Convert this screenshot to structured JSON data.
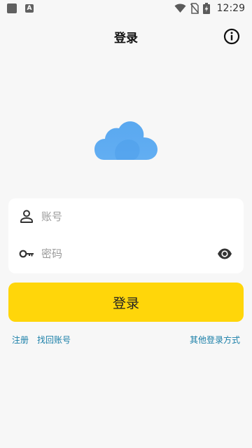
{
  "status_bar": {
    "time": "12:29",
    "icons": [
      "notification-square-icon",
      "a-badge-icon",
      "wifi-icon",
      "no-sim-icon",
      "battery-charging-icon"
    ]
  },
  "app_bar": {
    "title": "登录",
    "info_icon": "info-icon"
  },
  "logo": {
    "icon": "cloud-icon",
    "colors": [
      "#5aa8f0",
      "#4a9be9"
    ]
  },
  "form": {
    "account": {
      "icon": "user-icon",
      "placeholder": "账号",
      "value": ""
    },
    "password": {
      "icon": "key-icon",
      "placeholder": "密码",
      "value": "",
      "toggle_icon": "eye-icon"
    }
  },
  "login_button": {
    "label": "登录",
    "color": "#ffd60a"
  },
  "links": {
    "register": "注册",
    "find_account": "找回账号",
    "other_login": "其他登录方式",
    "color": "#1a7fa8"
  }
}
